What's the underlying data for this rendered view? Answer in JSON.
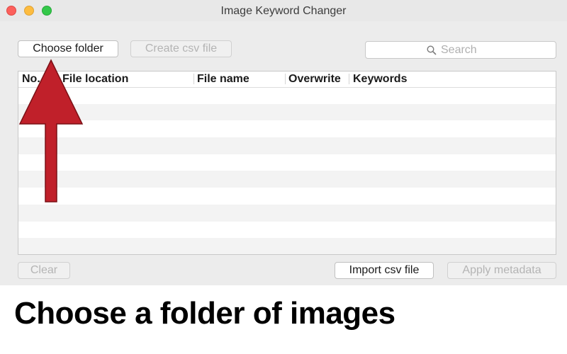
{
  "window": {
    "title": "Image Keyword Changer"
  },
  "toolbar": {
    "choose_folder": "Choose folder",
    "create_csv": "Create csv file",
    "search_placeholder": "Search"
  },
  "table": {
    "columns": [
      "No.",
      "File location",
      "File name",
      "Overwrite",
      "Keywords"
    ]
  },
  "footer": {
    "clear": "Clear",
    "import_csv": "Import csv file",
    "apply_metadata": "Apply metadata"
  },
  "caption": "Choose a folder of images",
  "colors": {
    "arrow": "#c0202a"
  }
}
